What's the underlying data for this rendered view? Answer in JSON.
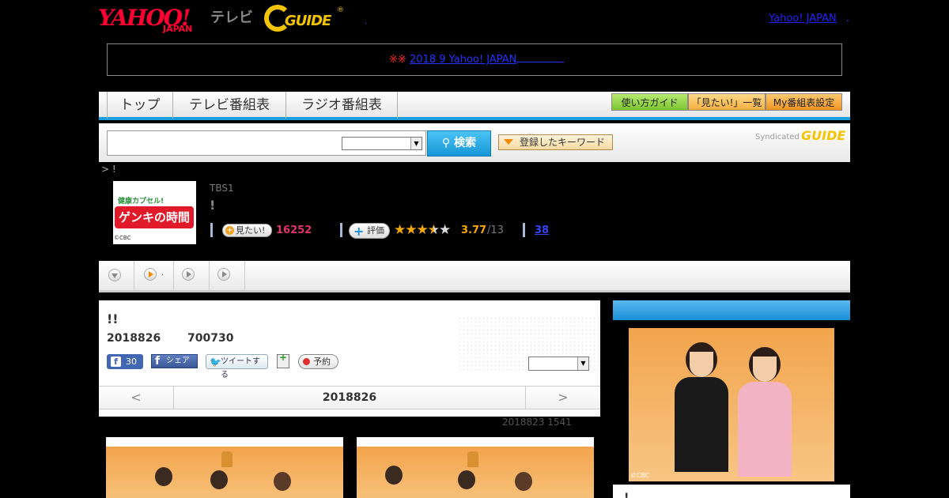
{
  "header": {
    "yahoo_logo": "YAHOO!",
    "yahoo_sub": "JAPAN",
    "tv_label": "テレビ",
    "gguide_logo": "GUIDE",
    "gguide_reg": "®",
    "sep_dot": ".",
    "yahoo_japan_link": "Yahoo! JAPAN",
    "yahoo_japan_dot": "."
  },
  "notice": {
    "mark": "※※",
    "link_text": "2018 9 Yahoo! JAPAN"
  },
  "nav": {
    "tabs": [
      {
        "label": "トップ"
      },
      {
        "label": "テレビ番組表"
      },
      {
        "label": "ラジオ番組表"
      }
    ],
    "guide_buttons": [
      {
        "label": "使い方ガイド",
        "color": "#8fd040"
      },
      {
        "label": "「見たい!」一覧",
        "color": "#f6b84a"
      },
      {
        "label": "My番組表設定",
        "color": "#f3a030"
      }
    ]
  },
  "search": {
    "input_value": "",
    "select_value": "",
    "button_label": "検索",
    "keyword_button_label": "登録したキーワード",
    "syndicated_label": "Syndicated",
    "syndicated_logo": "GUIDE"
  },
  "breadcrumb": "> !",
  "program": {
    "thumb_top": "健康カプセル!",
    "thumb_main": "ゲンキの時間",
    "thumb_credit": "©CBC",
    "channel": "TBS1",
    "title": "!",
    "miru_label": "見たい!",
    "miru_count": "16252",
    "rate_label": "評価",
    "rating": 3.77,
    "score_text": "3.77",
    "score_total": "/13",
    "reviews_link": "38"
  },
  "episode_nav": {
    "item_dot": "."
  },
  "episode": {
    "title": "!!",
    "date": "2018826",
    "time": "700730",
    "fb_like_count": "30",
    "fb_share_label": "シェア",
    "tweet_label": "ツイートする",
    "reserve_label": "予約",
    "select_value": "",
    "prev_label": "<",
    "current_date": "2018826",
    "next_label": ">",
    "updated": "2018823  1541"
  },
  "sidebar": {
    "image_credit": "©CBC",
    "caption": "!"
  },
  "colors": {
    "accent_blue": "#1aa0e0",
    "miru_pink": "#e0336f",
    "star_gold": "#f5a800"
  }
}
